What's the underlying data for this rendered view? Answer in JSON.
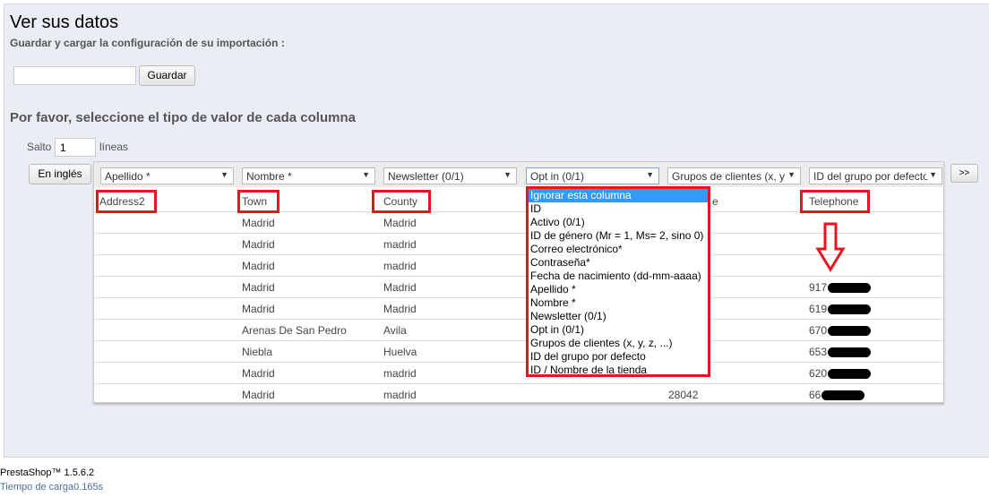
{
  "title": "Ver sus datos",
  "subtitle": "Guardar y cargar la configuración de su importación :",
  "config_name": {
    "value": "",
    "button": "Guardar"
  },
  "section_title": "Por favor, seleccione el tipo de valor de cada columna",
  "skip": {
    "label": "Salto",
    "value": "1",
    "unit": "líneas"
  },
  "lang_button": "En inglés",
  "next_button": ">>",
  "selects": [
    "Apellido *",
    "Nombre *",
    "Newsletter (0/1)",
    "Opt in (0/1)",
    "Grupos de clientes (x, y",
    "ID del grupo por defecto"
  ],
  "headers": [
    "Address2",
    "Town",
    "County",
    "",
    "e",
    "Telephone"
  ],
  "rows": [
    [
      "",
      "Madrid",
      "Madrid",
      "",
      "",
      ""
    ],
    [
      "",
      "Madrid",
      "madrid",
      "",
      "",
      ""
    ],
    [
      "",
      "Madrid",
      "madrid",
      "",
      "",
      ""
    ],
    [
      "",
      "Madrid",
      "Madrid",
      "",
      "",
      "917"
    ],
    [
      "",
      "Madrid",
      "Madrid",
      "",
      "",
      "619"
    ],
    [
      "",
      "Arenas De San Pedro",
      "Avila",
      "",
      "",
      "670"
    ],
    [
      "",
      "Niebla",
      "Huelva",
      "",
      "",
      "653"
    ],
    [
      "",
      "Madrid",
      "madrid",
      "",
      "",
      "620"
    ],
    [
      "",
      "Madrid",
      "madrid",
      "",
      "28042",
      "66"
    ]
  ],
  "dropdown_options": [
    "Ignorar esta columna",
    "ID",
    "Activo (0/1)",
    "ID de género (Mr = 1, Ms= 2, sino 0)",
    "Correo electrónico*",
    "Contraseña*",
    "Fecha de nacimiento (dd-mm-aaaa)",
    "Apellido *",
    "Nombre *",
    "Newsletter (0/1)",
    "Opt in (0/1)",
    "Grupos de clientes (x, y, z, ...)",
    "ID del grupo por defecto",
    "ID / Nombre de la tienda"
  ],
  "dropdown_selected": "Ignorar esta columna",
  "highlight_color": "#e8151f",
  "footer": {
    "version": "PrestaShop™ 1.5.6.2",
    "load_time": "Tiempo de carga0.165s"
  }
}
